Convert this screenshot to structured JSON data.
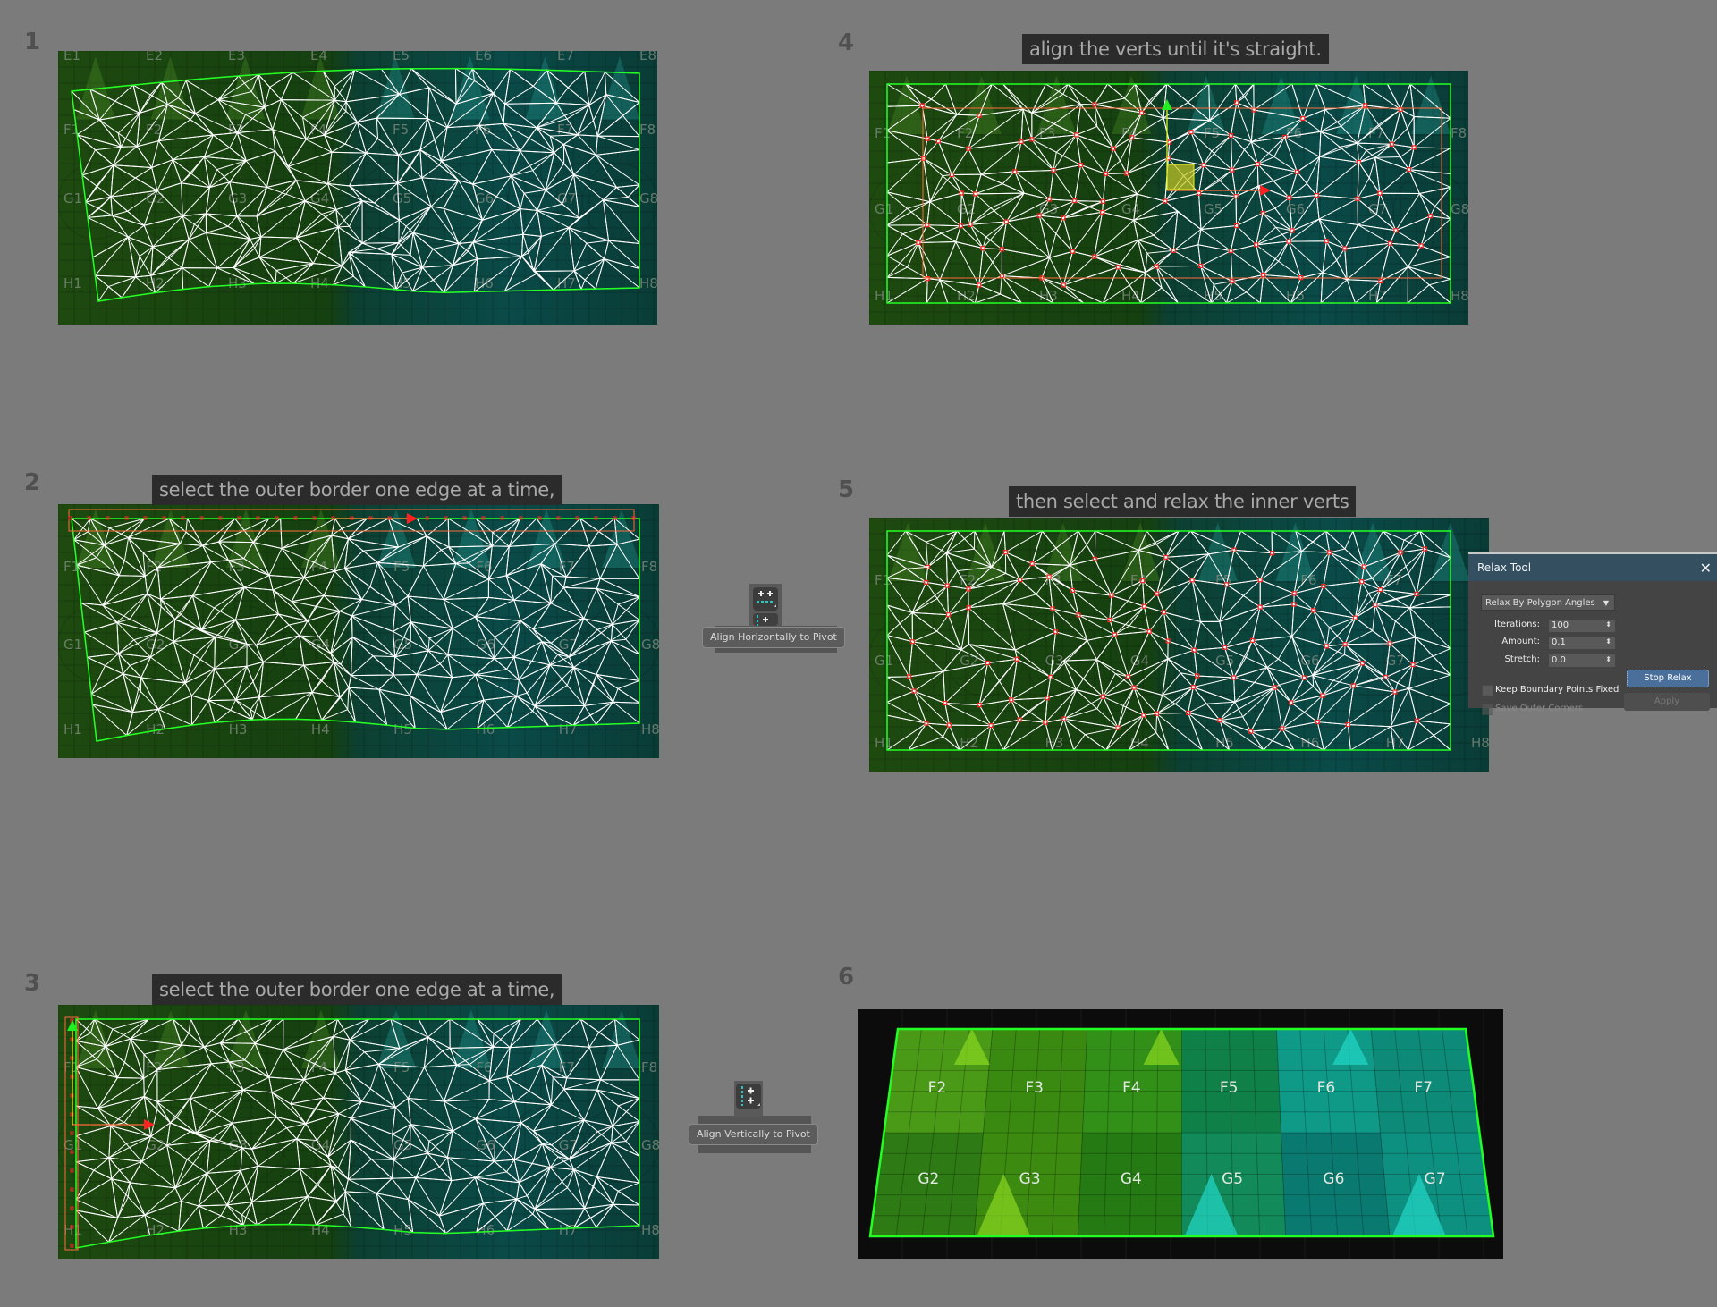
{
  "steps": [
    {
      "number": "1",
      "caption": null
    },
    {
      "number": "2",
      "caption": "select the outer border one edge at a time,"
    },
    {
      "number": "3",
      "caption": "select the outer border one edge at a time,"
    },
    {
      "number": "4",
      "caption": "align the verts until it's straight."
    },
    {
      "number": "5",
      "caption": "then select and relax the inner verts"
    },
    {
      "number": "6",
      "caption": null
    }
  ],
  "grid_labels": {
    "row_E": [
      "E1",
      "E2",
      "E3",
      "E4",
      "E5",
      "E6",
      "E7",
      "E8"
    ],
    "row_F": [
      "F1",
      "F2",
      "F3",
      "F4",
      "F5",
      "F6",
      "F7",
      "F8"
    ],
    "row_G": [
      "G1",
      "G2",
      "G3",
      "G4",
      "G5",
      "G6",
      "G7",
      "G8"
    ],
    "row_H": [
      "H1",
      "H2",
      "H3",
      "H4",
      "H5",
      "H6",
      "H7",
      "H8"
    ]
  },
  "final_labels": {
    "row_F": [
      "F2",
      "F3",
      "F4",
      "F5",
      "F6",
      "F7"
    ],
    "row_G": [
      "G2",
      "G3",
      "G4",
      "G5",
      "G6",
      "G7"
    ]
  },
  "align_tools": {
    "horizontal": {
      "icon": "align-horizontal-icon",
      "tooltip": "Align Horizontally to Pivot"
    },
    "vertical": {
      "icon": "align-vertical-icon",
      "tooltip": "Align Vertically to Pivot"
    }
  },
  "relax_tool": {
    "title": "Relax Tool",
    "close_icon": "close-icon",
    "mode": "Relax By Polygon Angles",
    "fields": [
      {
        "label": "Iterations:",
        "value": "100"
      },
      {
        "label": "Amount:",
        "value": "0.1"
      },
      {
        "label": "Stretch:",
        "value": "0.0"
      }
    ],
    "checkboxes": [
      {
        "label": "Keep Boundary Points Fixed",
        "checked": false,
        "enabled": true
      },
      {
        "label": "Save Outer Corners",
        "checked": false,
        "enabled": false
      }
    ],
    "stop_button": "Stop Relax",
    "apply_button": "Apply"
  },
  "colors": {
    "background": "#7b7b7b",
    "uv_border": "#22ff22",
    "wire": "#ffffff",
    "selection": "#ff6a3a",
    "vertex_selected": "#ff2020",
    "gizmo_x": "#ff2020",
    "gizmo_y": "#22ee22",
    "relax_title_bar": "#344f60",
    "stop_button": "#4a6f9b"
  }
}
